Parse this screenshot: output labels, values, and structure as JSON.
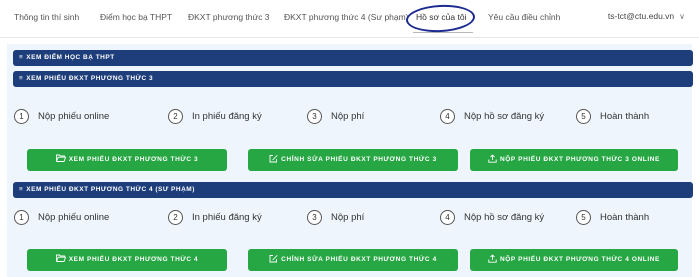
{
  "nav": {
    "items": [
      "Thông tin thí sinh",
      "Điểm học bạ THPT",
      "ĐKXT phương thức 3",
      "ĐKXT phương thức 4 (Sư phạm)",
      "Hồ sơ của tôi",
      "Yêu cầu điều chỉnh"
    ],
    "active": "Hồ sơ của tôi",
    "user_email": "ts-tct@ctu.edu.vn"
  },
  "sections": {
    "hoc_ba": "XEM ĐIỂM HỌC BẠ THPT",
    "pt3": "XEM PHIẾU ĐKXT PHƯƠNG THỨC 3",
    "pt4": "XEM PHIẾU ĐKXT PHƯƠNG THỨC 4 (SƯ PHẠM)"
  },
  "steps": [
    {
      "num": "1",
      "label": "Nộp phiếu online"
    },
    {
      "num": "2",
      "label": "In phiếu đăng ký"
    },
    {
      "num": "3",
      "label": "Nộp phí"
    },
    {
      "num": "4",
      "label": "Nộp hồ sơ đăng ký"
    },
    {
      "num": "5",
      "label": "Hoàn thành"
    }
  ],
  "buttons_pt3": {
    "view": "XEM PHIẾU ĐKXT PHƯƠNG THỨC 3",
    "edit": "CHỈNH SỬA PHIẾU ĐKXT PHƯƠNG THỨC 3",
    "submit": "NỘP PHIẾU ĐKXT PHƯƠNG THỨC 3 ONLINE"
  },
  "buttons_pt4": {
    "view": "XEM PHIẾU ĐKXT PHƯƠNG THỨC 4",
    "edit": "CHỈNH SỬA PHIẾU ĐKXT PHƯƠNG THỨC 4",
    "submit": "NỘP PHIẾU ĐKXT PHƯƠNG THỨC 4 ONLINE"
  },
  "colors": {
    "section_bar": "#1e3d7b",
    "button_green": "#27a744",
    "panel_bg": "#eef5fc",
    "annotation_circle": "#1c2b8f"
  }
}
